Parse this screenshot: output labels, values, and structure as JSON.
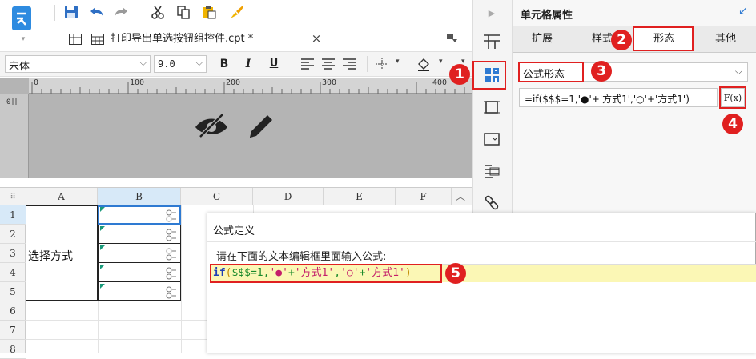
{
  "app": {
    "logo": "report-designer-logo"
  },
  "toolbar": {
    "icons": [
      "save-icon",
      "undo-icon",
      "redo-icon",
      "cut-icon",
      "copy-icon",
      "paste-icon",
      "format-brush-icon"
    ]
  },
  "tab": {
    "title": "打印导出单选按钮组控件.cpt *",
    "close": "×"
  },
  "format_bar": {
    "font": "宋体",
    "size": "9.0",
    "bold": "B",
    "italic": "I",
    "underline": "U"
  },
  "ruler": {
    "ticks": [
      "0",
      "100",
      "200",
      "300",
      "400"
    ]
  },
  "sheet": {
    "columns": [
      "A",
      "B",
      "C",
      "D",
      "E",
      "F"
    ],
    "rows": [
      "1",
      "2",
      "3",
      "4",
      "5",
      "6",
      "7",
      "8"
    ],
    "merged_cell_text": "选择方式"
  },
  "right_panel": {
    "title": "单元格属性",
    "tabs": [
      "扩展",
      "样式",
      "形态",
      "其他"
    ],
    "active_tab": "形态",
    "form_select": "公式形态",
    "formula_value": "=if($$$=1,'●'+'方式1','○'+'方式1')",
    "fx_label": "F(x)"
  },
  "dialog": {
    "title": "公式定义",
    "prompt": "请在下面的文本编辑框里面输入公式:",
    "formula": {
      "kw": "if",
      "open": "(",
      "cond": "$$$=1,",
      "a1": "'●'",
      "plus1": "+",
      "a2": "'方式1'",
      "comma": ",",
      "b1": "'○'",
      "plus2": "+",
      "b2": "'方式1'",
      "close": ")"
    }
  },
  "badges": [
    "1",
    "2",
    "3",
    "4",
    "5"
  ],
  "colors": {
    "accent": "#1a73c8",
    "highlight": "#fbf7b5",
    "badge": "#e02020"
  }
}
